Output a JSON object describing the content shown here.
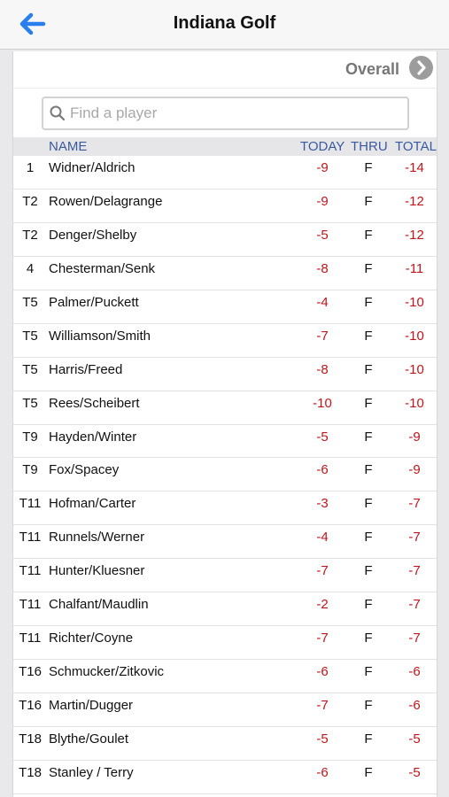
{
  "navbar": {
    "title": "Indiana Golf",
    "back_icon": "arrow-left-icon",
    "accent": "#2a7ff0"
  },
  "overall": {
    "label": "Overall",
    "icon": "chevron-right-icon"
  },
  "search": {
    "placeholder": "Find a player",
    "icon": "search-icon"
  },
  "columns": {
    "name": "NAME",
    "today": "TODAY",
    "thru": "THRU",
    "total": "TOTAL"
  },
  "colors": {
    "score_red": "#c0151c",
    "header_blue": "#3a5aa0"
  },
  "players": [
    {
      "pos": "1",
      "name": "Widner/Aldrich",
      "today": "-9",
      "thru": "F",
      "total": "-14"
    },
    {
      "pos": "T2",
      "name": "Rowen/Delagrange",
      "today": "-9",
      "thru": "F",
      "total": "-12"
    },
    {
      "pos": "T2",
      "name": "Denger/Shelby",
      "today": "-5",
      "thru": "F",
      "total": "-12"
    },
    {
      "pos": "4",
      "name": "Chesterman/Senk",
      "today": "-8",
      "thru": "F",
      "total": "-11"
    },
    {
      "pos": "T5",
      "name": "Palmer/Puckett",
      "today": "-4",
      "thru": "F",
      "total": "-10"
    },
    {
      "pos": "T5",
      "name": "Williamson/Smith",
      "today": "-7",
      "thru": "F",
      "total": "-10"
    },
    {
      "pos": "T5",
      "name": "Harris/Freed",
      "today": "-8",
      "thru": "F",
      "total": "-10"
    },
    {
      "pos": "T5",
      "name": "Rees/Scheibert",
      "today": "-10",
      "thru": "F",
      "total": "-10"
    },
    {
      "pos": "T9",
      "name": "Hayden/Winter",
      "today": "-5",
      "thru": "F",
      "total": "-9"
    },
    {
      "pos": "T9",
      "name": "Fox/Spacey",
      "today": "-6",
      "thru": "F",
      "total": "-9"
    },
    {
      "pos": "T11",
      "name": "Hofman/Carter",
      "today": "-3",
      "thru": "F",
      "total": "-7"
    },
    {
      "pos": "T11",
      "name": "Runnels/Werner",
      "today": "-4",
      "thru": "F",
      "total": "-7"
    },
    {
      "pos": "T11",
      "name": "Hunter/Kluesner",
      "today": "-7",
      "thru": "F",
      "total": "-7"
    },
    {
      "pos": "T11",
      "name": "Chalfant/Maudlin",
      "today": "-2",
      "thru": "F",
      "total": "-7"
    },
    {
      "pos": "T11",
      "name": "Richter/Coyne",
      "today": "-7",
      "thru": "F",
      "total": "-7"
    },
    {
      "pos": "T16",
      "name": "Schmucker/Zitkovic",
      "today": "-6",
      "thru": "F",
      "total": "-6"
    },
    {
      "pos": "T16",
      "name": "Martin/Dugger",
      "today": "-7",
      "thru": "F",
      "total": "-6"
    },
    {
      "pos": "T18",
      "name": "Blythe/Goulet",
      "today": "-5",
      "thru": "F",
      "total": "-5"
    },
    {
      "pos": "T18",
      "name": "Stanley / Terry",
      "today": "-6",
      "thru": "F",
      "total": "-5"
    }
  ]
}
